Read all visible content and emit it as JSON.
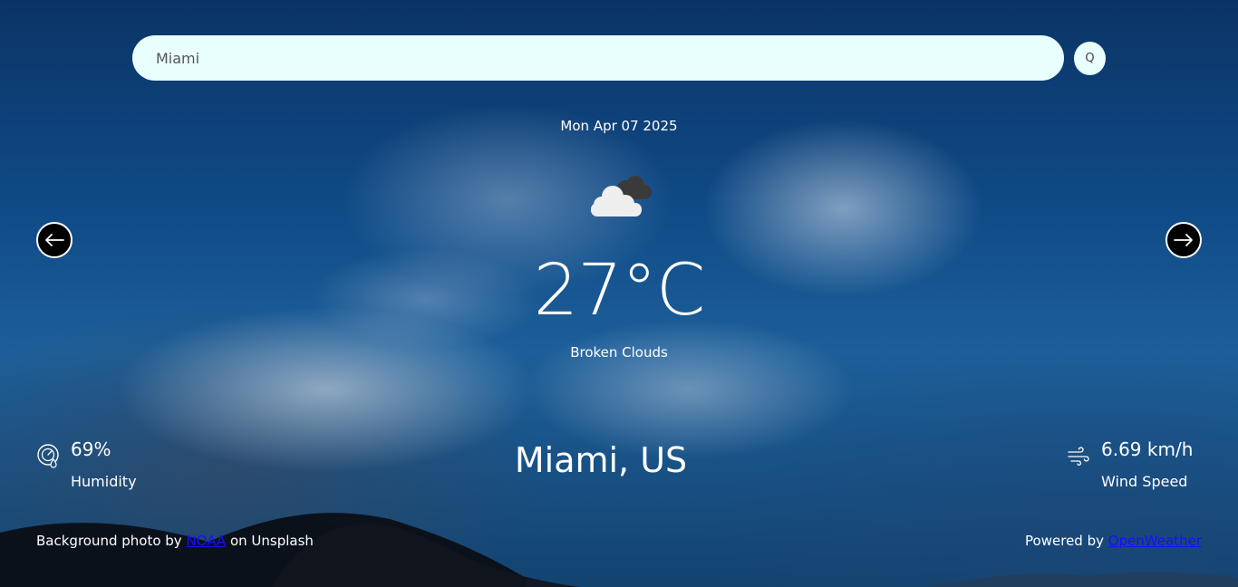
{
  "search": {
    "value": "Miami",
    "button_label": "Q"
  },
  "weather": {
    "date": "Mon Apr 07 2025",
    "icon": "broken-clouds-icon",
    "temperature": "27°C",
    "condition": "Broken Clouds",
    "location": "Miami, US"
  },
  "stats": {
    "humidity": {
      "value": "69%",
      "label": "Humidity",
      "icon": "humidity-gauge-icon"
    },
    "wind": {
      "value": "6.69 km/h",
      "label": "Wind Speed",
      "icon": "wind-icon"
    }
  },
  "navigation": {
    "prev_icon": "arrow-left-icon",
    "next_icon": "arrow-right-icon"
  },
  "footer": {
    "left_prefix": "Background photo by ",
    "left_link": "NOAA",
    "left_suffix": " on Unsplash",
    "right_prefix": "Powered by ",
    "right_link": "OpenWeather"
  },
  "colors": {
    "search_bg": "#e9fffd",
    "link": "#1a0dff",
    "text": "#ffffff"
  }
}
